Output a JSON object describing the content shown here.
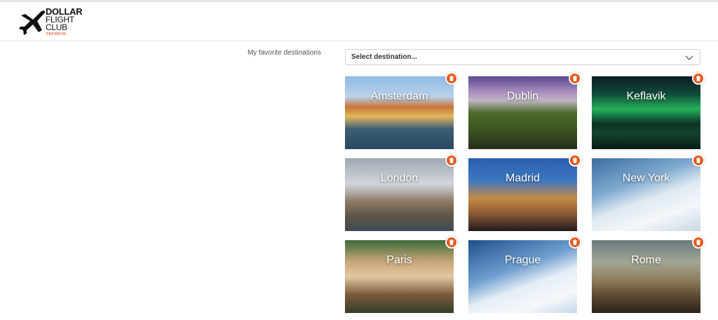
{
  "header": {
    "logo": {
      "line1": "DOLLAR",
      "line2": "FLIGHT",
      "line3": "CLUB",
      "line4": "PREMIUM"
    }
  },
  "favorites": {
    "label": "My favorite destinations",
    "select_placeholder": "Select destination..."
  },
  "destinations": [
    {
      "name": "Amsterdam"
    },
    {
      "name": "Dublin"
    },
    {
      "name": "Keflavik"
    },
    {
      "name": "London"
    },
    {
      "name": "Madrid"
    },
    {
      "name": "New York"
    },
    {
      "name": "Paris"
    },
    {
      "name": "Prague"
    },
    {
      "name": "Rome"
    }
  ],
  "colors": {
    "delete_badge": "#e55a1c",
    "logo_premium": "#d9331d"
  },
  "icons": {
    "delete": "trash-icon",
    "dropdown": "chevron-down-icon",
    "logo": "airplane-icon"
  }
}
